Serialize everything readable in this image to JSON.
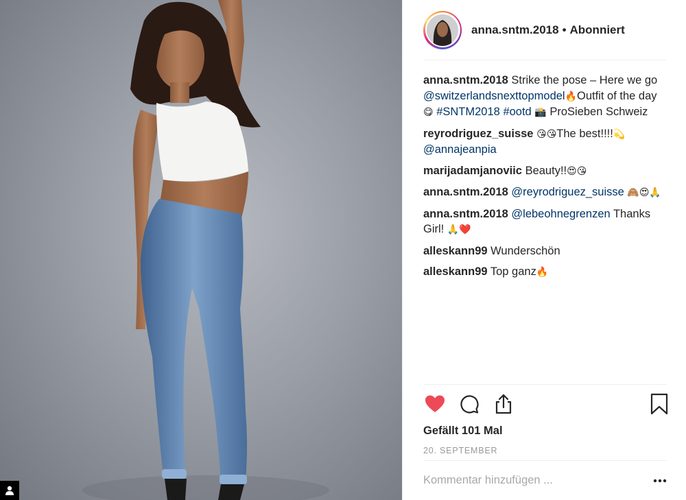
{
  "header": {
    "username": "anna.sntm.2018",
    "separator": "•",
    "follow_status": "Abonniert"
  },
  "comments": [
    {
      "user": "anna.sntm.2018",
      "segments": [
        {
          "t": "text",
          "v": " Strike the pose – Here we go "
        },
        {
          "t": "link",
          "v": "@switzerlandsnexttopmodel"
        },
        {
          "t": "emoji",
          "v": "🔥"
        },
        {
          "t": "text",
          "v": "Outfit of the day "
        },
        {
          "t": "emoji",
          "v": "😋"
        },
        {
          "t": "text",
          "v": " "
        },
        {
          "t": "link",
          "v": "#SNTM2018"
        },
        {
          "t": "text",
          "v": " "
        },
        {
          "t": "link",
          "v": "#ootd"
        },
        {
          "t": "text",
          "v": " "
        },
        {
          "t": "emoji",
          "v": "📸"
        },
        {
          "t": "text",
          "v": " ProSieben Schweiz"
        }
      ]
    },
    {
      "user": "reyrodriguez_suisse",
      "segments": [
        {
          "t": "text",
          "v": " "
        },
        {
          "t": "emoji",
          "v": "😘😘"
        },
        {
          "t": "text",
          "v": "The best!!!!"
        },
        {
          "t": "emoji",
          "v": "💫"
        },
        {
          "t": "text",
          "v": " "
        },
        {
          "t": "link",
          "v": "@annajeanpia"
        }
      ]
    },
    {
      "user": "marijadamjanoviic",
      "segments": [
        {
          "t": "text",
          "v": " Beauty!!"
        },
        {
          "t": "emoji",
          "v": "😍😘"
        }
      ]
    },
    {
      "user": "anna.sntm.2018",
      "segments": [
        {
          "t": "text",
          "v": " "
        },
        {
          "t": "link",
          "v": "@reyrodriguez_suisse"
        },
        {
          "t": "text",
          "v": " "
        },
        {
          "t": "emoji",
          "v": "🙈😍🙏"
        }
      ]
    },
    {
      "user": "anna.sntm.2018",
      "segments": [
        {
          "t": "text",
          "v": " "
        },
        {
          "t": "link",
          "v": "@lebeohnegrenzen"
        },
        {
          "t": "text",
          "v": " Thanks Girl! "
        },
        {
          "t": "emoji",
          "v": "🙏❤️"
        }
      ]
    },
    {
      "user": "alleskann99",
      "segments": [
        {
          "t": "text",
          "v": " Wunderschön"
        }
      ]
    },
    {
      "user": "alleskann99",
      "segments": [
        {
          "t": "text",
          "v": " Top ganz"
        },
        {
          "t": "emoji",
          "v": "🔥"
        }
      ]
    }
  ],
  "actions": {
    "like_icon": "heart-filled-icon",
    "comment_icon": "comment-bubble-icon",
    "share_icon": "share-upload-icon",
    "save_icon": "bookmark-icon",
    "like_color": "#ed4956"
  },
  "likes_text": "Gefällt 101 Mal",
  "date_text": "20. SEPTEMBER",
  "comment_input": {
    "placeholder": "Kommentar hinzufügen ...",
    "value": ""
  },
  "more_icon": "ellipsis-icon"
}
